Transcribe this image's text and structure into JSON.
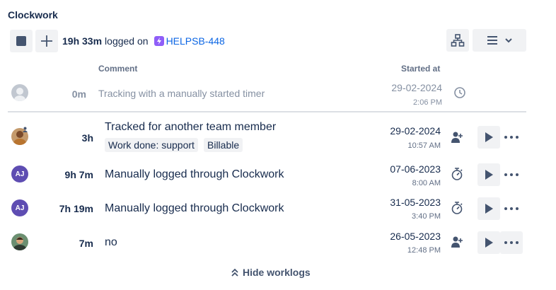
{
  "app": {
    "title": "Clockwork"
  },
  "toolbar": {
    "stop": "stop-icon",
    "add": "plus-icon",
    "hierarchy": "hierarchy-icon",
    "menu": "menu-icon",
    "dropdown": "chevron-down-icon"
  },
  "summary": {
    "total": "19h 33m",
    "logged_on": "logged on",
    "issue_key": "HELPSB-448"
  },
  "columns": {
    "comment": "Comment",
    "started_at": "Started at"
  },
  "timer": {
    "duration": "0m",
    "comment": "Tracking with a manually started timer",
    "date": "29-02-2024",
    "time": "2:06 PM"
  },
  "worklogs": [
    {
      "duration": "3h",
      "comment": "Tracked for another team member",
      "tags": [
        "Work done: support",
        "Billable"
      ],
      "date": "29-02-2024",
      "time": "10:57 AM",
      "type_icon": "user-add-icon"
    },
    {
      "duration": "9h 7m",
      "initials": "AJ",
      "comment": "Manually logged through Clockwork",
      "date": "07-06-2023",
      "time": "8:00 AM",
      "type_icon": "stopwatch-icon"
    },
    {
      "duration": "7h 19m",
      "initials": "AJ",
      "comment": "Manually logged through Clockwork",
      "date": "31-05-2023",
      "time": "3:40 PM",
      "type_icon": "stopwatch-icon"
    },
    {
      "duration": "7m",
      "comment": "no",
      "date": "26-05-2023",
      "time": "12:48 PM",
      "type_icon": "user-add-icon"
    }
  ],
  "footer": {
    "hide_label": "Hide worklogs"
  },
  "colors": {
    "accent": "#0c66e4",
    "issue_icon": "#8f5ef8",
    "avatar_aj": "#5e4db2",
    "text": "#172b4d",
    "muted": "#626f86"
  }
}
